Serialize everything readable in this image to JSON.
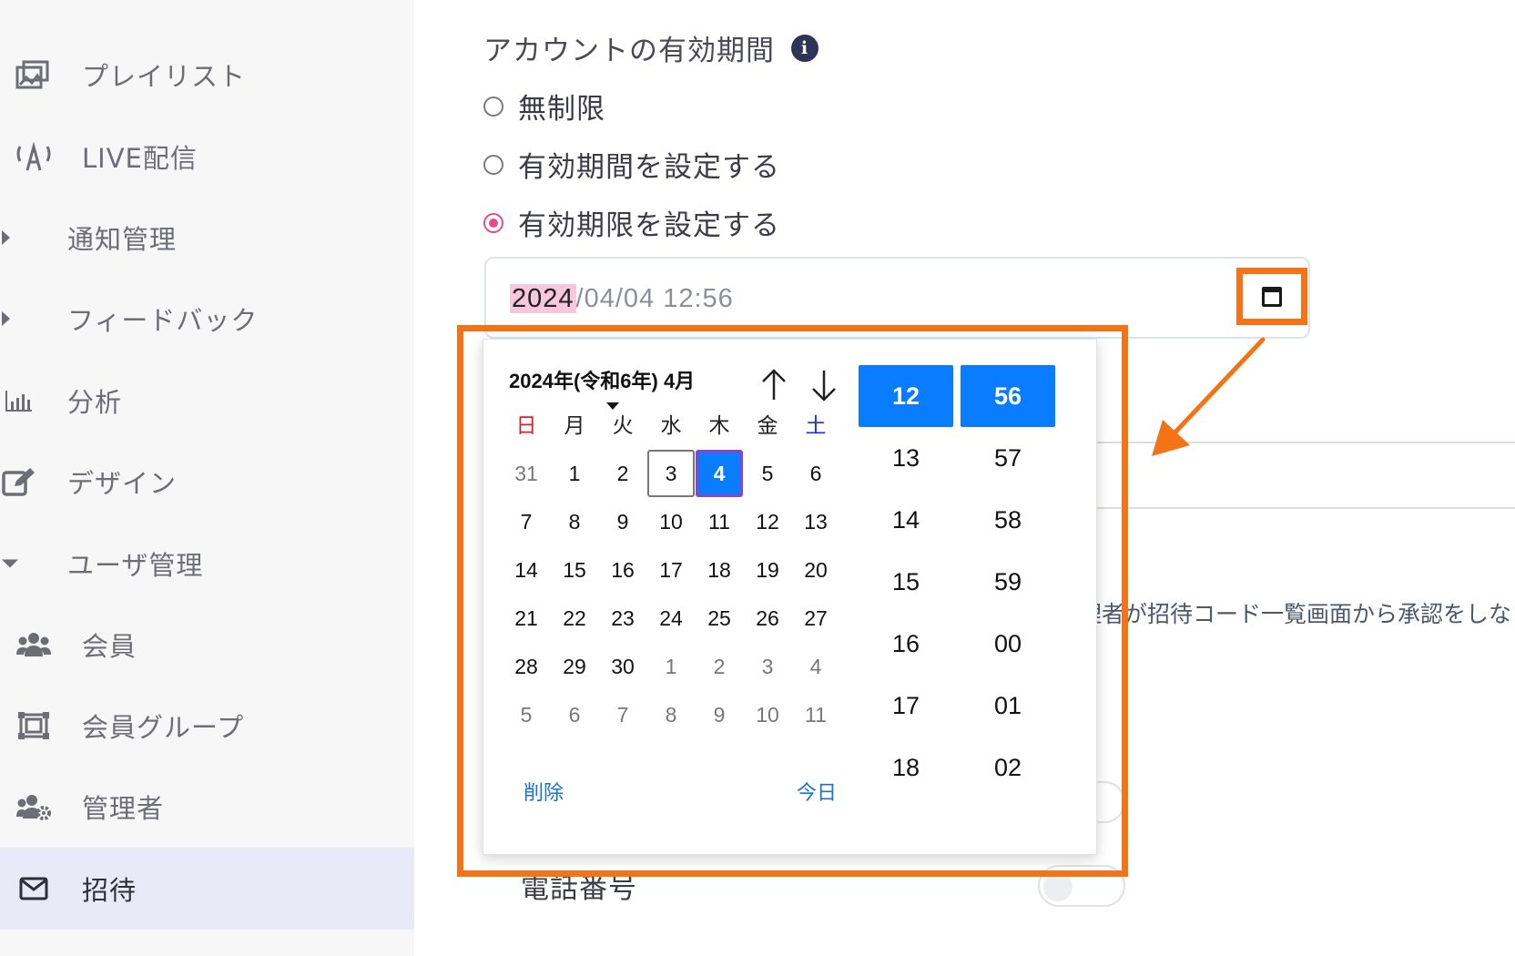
{
  "sidebar": {
    "items": [
      {
        "label": "プレイリスト",
        "icon": "playlist-icon"
      },
      {
        "label": "LIVE配信",
        "icon": "live-broadcast-icon"
      },
      {
        "label": "通知管理",
        "icon": "caret-right-icon"
      },
      {
        "label": "フィードバック",
        "icon": "caret-right-icon"
      },
      {
        "label": "分析",
        "icon": "bar-chart-icon"
      },
      {
        "label": "デザイン",
        "icon": "edit-icon"
      },
      {
        "label": "ユーザ管理",
        "icon": "caret-down-icon"
      },
      {
        "label": "会員",
        "icon": "users-icon"
      },
      {
        "label": "会員グループ",
        "icon": "group-frame-icon"
      },
      {
        "label": "管理者",
        "icon": "admin-users-icon"
      },
      {
        "label": "招待",
        "icon": "envelope-icon"
      }
    ],
    "active": "招待"
  },
  "form": {
    "section_title": "アカウントの有効期間",
    "options": [
      "無制限",
      "有効期間を設定する",
      "有効期限を設定する"
    ],
    "selected_option": "有効期限を設定する",
    "date_year": "2024",
    "date_rest": "/04/04 12:56",
    "invite_text": "理者が招待コード一覧画面から承認をしな",
    "phone_label": "電話番号"
  },
  "picker": {
    "month_title": "2024年(令和6年) 4月",
    "weekdays": [
      "日",
      "月",
      "火",
      "水",
      "木",
      "金",
      "土"
    ],
    "weeks": [
      [
        "31",
        "1",
        "2",
        "3",
        "4",
        "5",
        "6"
      ],
      [
        "7",
        "8",
        "9",
        "10",
        "11",
        "12",
        "13"
      ],
      [
        "14",
        "15",
        "16",
        "17",
        "18",
        "19",
        "20"
      ],
      [
        "21",
        "22",
        "23",
        "24",
        "25",
        "26",
        "27"
      ],
      [
        "28",
        "29",
        "30",
        "1",
        "2",
        "3",
        "4"
      ],
      [
        "5",
        "6",
        "7",
        "8",
        "9",
        "10",
        "11"
      ]
    ],
    "selected_day": "4",
    "today_day": "3",
    "clear_label": "削除",
    "today_label": "今日",
    "hours": [
      "12",
      "13",
      "14",
      "15",
      "16",
      "17",
      "18"
    ],
    "minutes": [
      "56",
      "57",
      "58",
      "59",
      "00",
      "01",
      "02"
    ],
    "selected_hour": "12",
    "selected_minute": "56"
  },
  "colors": {
    "accent": "#0a7cff",
    "highlight": "#f47316",
    "radio": "#e64b8c",
    "link": "#1a73c8"
  }
}
